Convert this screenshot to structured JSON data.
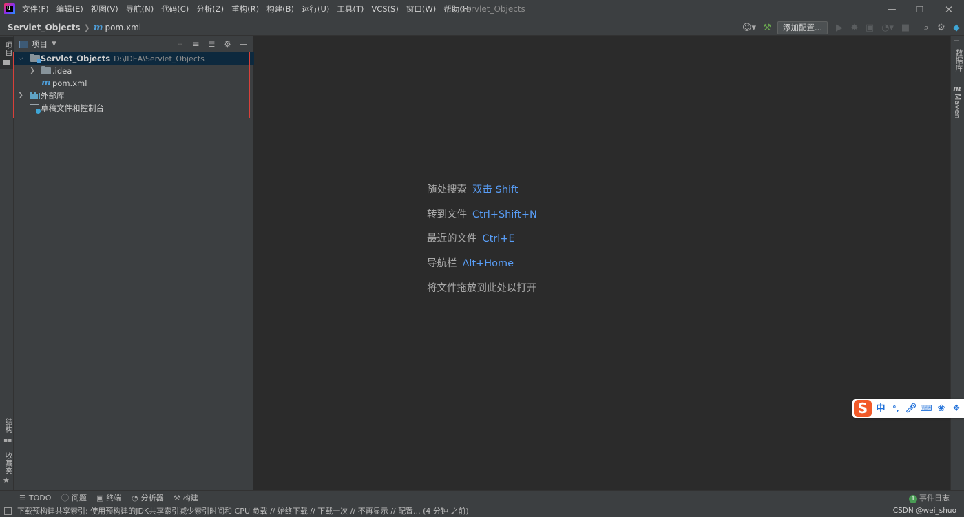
{
  "menubar": {
    "items": [
      "文件(F)",
      "编辑(E)",
      "视图(V)",
      "导航(N)",
      "代码(C)",
      "分析(Z)",
      "重构(R)",
      "构建(B)",
      "运行(U)",
      "工具(T)",
      "VCS(S)",
      "窗口(W)",
      "帮助(H)"
    ],
    "window_title": "Servlet_Objects",
    "logo_text": "IJ"
  },
  "navbar": {
    "project": "Servlet_Objects",
    "file_icon": "m",
    "file": "pom.xml",
    "add_config": "添加配置..."
  },
  "left_strip": {
    "project_tab": "项目",
    "structure_tab": "结构",
    "favorites_tab": "收藏夹"
  },
  "right_strip": {
    "database_tab": "数据库",
    "maven_icon": "m",
    "maven_tab": "Maven"
  },
  "project_panel": {
    "title": "项目",
    "tree": {
      "root": {
        "name": "Servlet_Objects",
        "path": "D:\\IDEA\\Servlet_Objects"
      },
      "idea": ".idea",
      "pom_icon": "m",
      "pom": "pom.xml",
      "external_libs": "外部库",
      "scratches": "草稿文件和控制台"
    }
  },
  "editor": {
    "hints": [
      {
        "label": "随处搜索",
        "key": "双击 Shift"
      },
      {
        "label": "转到文件",
        "key": "Ctrl+Shift+N"
      },
      {
        "label": "最近的文件",
        "key": "Ctrl+E"
      },
      {
        "label": "导航栏",
        "key": "Alt+Home"
      },
      {
        "label": "将文件拖放到此处以打开",
        "key": ""
      }
    ]
  },
  "ime": {
    "logo": "S",
    "items": [
      "中",
      "°,"
    ]
  },
  "bottom_tools": {
    "todo": "TODO",
    "problems": "问题",
    "terminal": "终端",
    "profiler": "分析器",
    "build": "构建",
    "event_log": "事件日志",
    "event_count": "1"
  },
  "statusbar": {
    "message": "下载预构建共享索引: 使用预构建的JDK共享索引减少索引时间和 CPU 负载 // 始终下载 // 下载一次 // 不再显示 // 配置... (4 分钟 之前)",
    "watermark": "CSDN @wei_shuo"
  },
  "colors": {
    "accent": "#589df6",
    "selection": "#0d293e",
    "highlight_box": "#d9403a",
    "panel_bg": "#3c3f41",
    "editor_bg": "#2b2b2b"
  }
}
